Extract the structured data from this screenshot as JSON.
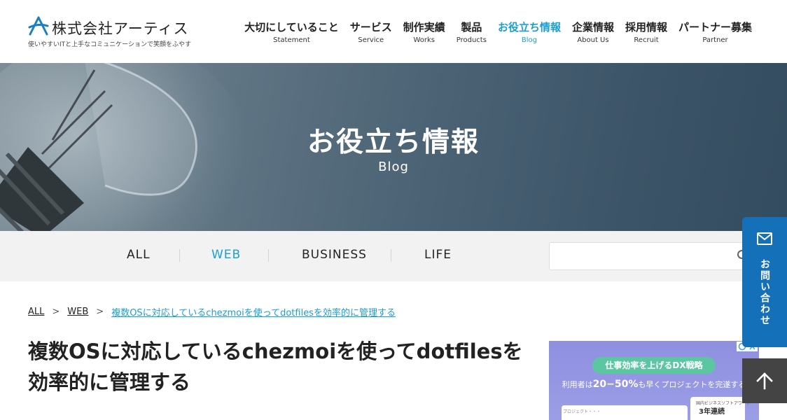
{
  "header": {
    "logo_name": "株式会社アーティス",
    "logo_tagline": "使いやすいITと上手なコミュニケーションで笑顔をふやす",
    "nav": [
      {
        "jp": "大切にしていること",
        "en": "Statement"
      },
      {
        "jp": "サービス",
        "en": "Service"
      },
      {
        "jp": "制作実績",
        "en": "Works"
      },
      {
        "jp": "製品",
        "en": "Products"
      },
      {
        "jp": "お役立ち情報",
        "en": "Blog"
      },
      {
        "jp": "企業情報",
        "en": "About Us"
      },
      {
        "jp": "採用情報",
        "en": "Recruit"
      },
      {
        "jp": "パートナー募集",
        "en": "Partner"
      }
    ],
    "active_nav": "Blog"
  },
  "hero": {
    "title": "お役立ち情報",
    "subtitle": "Blog"
  },
  "categories": {
    "items": [
      "ALL",
      "WEB",
      "BUSINESS",
      "LIFE"
    ],
    "active": "WEB"
  },
  "search": {
    "placeholder": ""
  },
  "breadcrumb": {
    "items": [
      "ALL",
      "WEB",
      "複数OSに対応しているchezmoiを使ってdotfilesを効率的に管理する"
    ],
    "separator": ">"
  },
  "article": {
    "title": "複数OSに対応しているchezmoiを使ってdotfilesを効率的に管理する"
  },
  "ad": {
    "badge": "仕事効率を上げるDX戦略",
    "line_prefix": "利用者は",
    "line_highlight": "20−50%",
    "line_suffix": "も早くプロジェクトを完遂する",
    "card_text": "プロジェクト・・・",
    "award_small": "国内ビジネスソフトアワード",
    "award_big": "3年連続"
  },
  "contact": {
    "label": "お問い合わせ"
  },
  "colors": {
    "accent": "#1a9fd0",
    "contact_bg": "#1470b9",
    "totop_bg": "#444444",
    "catbar_bg": "#f2f2f2",
    "ad_bg": "#9b9ee6",
    "ad_badge": "#5cc6a3"
  }
}
